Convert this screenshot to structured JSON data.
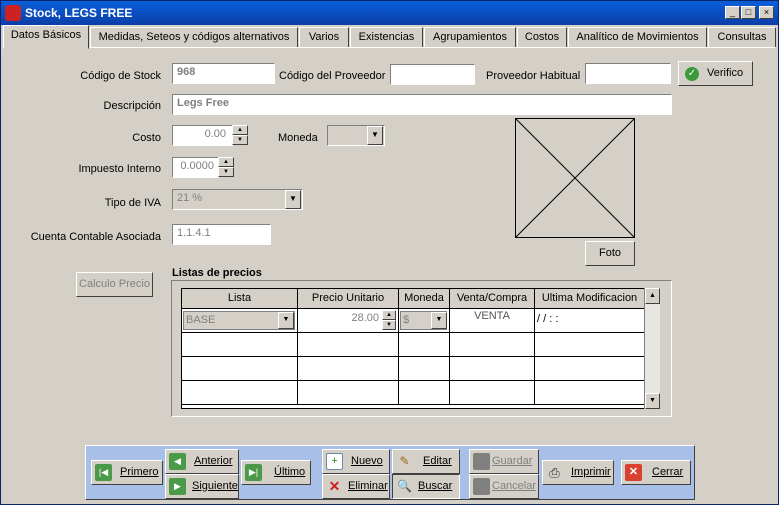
{
  "window": {
    "title": "Stock, LEGS FREE"
  },
  "tabs": [
    {
      "label": "Datos Básicos",
      "active": true
    },
    {
      "label": "Medidas, Seteos y códigos alternativos"
    },
    {
      "label": "Varios"
    },
    {
      "label": "Existencias"
    },
    {
      "label": "Agrupamientos"
    },
    {
      "label": "Costos"
    },
    {
      "label": "Analítico de Movimientos"
    },
    {
      "label": "Consultas"
    }
  ],
  "form": {
    "codigo_stock_label": "Código de Stock",
    "codigo_stock_value": "968",
    "codigo_proveedor_label": "Código del Proveedor",
    "codigo_proveedor_value": "",
    "proveedor_habitual_label": "Proveedor Habitual",
    "proveedor_habitual_value": "",
    "verifico_label": "Verifico",
    "descripcion_label": "Descripción",
    "descripcion_value": "Legs Free",
    "costo_label": "Costo",
    "costo_value": "0.00",
    "moneda_label": "Moneda",
    "moneda_value": "",
    "impuesto_label": "Impuesto Interno",
    "impuesto_value": "0.0000",
    "tipo_iva_label": "Tipo de IVA",
    "tipo_iva_value": "21 %",
    "cuenta_label": "Cuenta Contable Asociada",
    "cuenta_value": "1.1.4.1",
    "foto_label": "Foto",
    "calculo_label": "Calculo Precio"
  },
  "prices": {
    "title": "Listas de precios",
    "headers": [
      "Lista",
      "Precio Unitario",
      "Moneda",
      "Venta/Compra",
      "Ultima Modificacion"
    ],
    "row": {
      "lista": "BASE",
      "precio": "28.00",
      "moneda": "$",
      "venta": "VENTA",
      "ultima": "/ /      : :"
    }
  },
  "nav": {
    "primero": "Primero",
    "anterior": "Anterior",
    "siguiente": "Siguiente",
    "ultimo": "Último",
    "nuevo": "Nuevo",
    "eliminar": "Eliminar",
    "editar": "Editar",
    "buscar": "Buscar",
    "guardar": "Guardar",
    "cancelar": "Cancelar",
    "imprimir": "Imprimir",
    "cerrar": "Cerrar"
  }
}
